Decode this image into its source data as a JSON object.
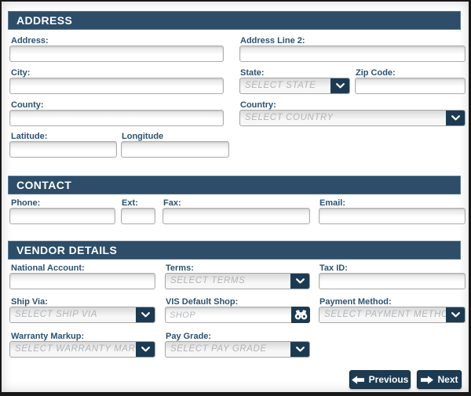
{
  "colors": {
    "header_bar": "#2d4d68",
    "button": "#1c3b52",
    "label_text": "#2d5170",
    "placeholder_text": "#b2b5b8"
  },
  "address": {
    "title": "ADDRESS",
    "fields": {
      "address": {
        "label": "Address:",
        "value": ""
      },
      "address2": {
        "label": "Address Line 2:",
        "value": ""
      },
      "city": {
        "label": "City:",
        "value": ""
      },
      "state": {
        "label": "State:",
        "placeholder": "SELECT STATE"
      },
      "zip": {
        "label": "Zip Code:",
        "value": ""
      },
      "county": {
        "label": "County:",
        "value": ""
      },
      "country": {
        "label": "Country:",
        "placeholder": "SELECT COUNTRY"
      },
      "latitude": {
        "label": "Latitude:",
        "value": ""
      },
      "longitude": {
        "label": "Longitude",
        "value": ""
      }
    }
  },
  "contact": {
    "title": "CONTACT",
    "fields": {
      "phone": {
        "label": "Phone:",
        "value": ""
      },
      "ext": {
        "label": "Ext:",
        "value": ""
      },
      "fax": {
        "label": "Fax:",
        "value": ""
      },
      "email": {
        "label": "Email:",
        "value": ""
      }
    }
  },
  "vendor": {
    "title": "VENDOR DETAILS",
    "fields": {
      "national_account": {
        "label": "National Account:",
        "value": ""
      },
      "terms": {
        "label": "Terms:",
        "placeholder": "SELECT TERMS"
      },
      "tax_id": {
        "label": "Tax ID:",
        "value": ""
      },
      "ship_via": {
        "label": "Ship Via:",
        "placeholder": "SELECT SHIP VIA"
      },
      "vis_default_shop": {
        "label": "VIS Default Shop:",
        "placeholder": "SHOP",
        "value": ""
      },
      "payment_method": {
        "label": "Payment Method:",
        "placeholder": "SELECT PAYMENT METHOD"
      },
      "warranty_markup": {
        "label": "Warranty Markup:",
        "placeholder": "SELECT WARRANTY MARKUP"
      },
      "pay_grade": {
        "label": "Pay Grade:",
        "placeholder": "SELECT PAY GRADE"
      }
    }
  },
  "nav": {
    "previous_label": "Previous",
    "next_label": "Next"
  },
  "icons": {
    "select_chevron": "chevron-down-icon",
    "shop_lookup": "binoculars-icon",
    "previous_arrow": "arrow-left-icon",
    "next_arrow": "arrow-right-icon"
  }
}
